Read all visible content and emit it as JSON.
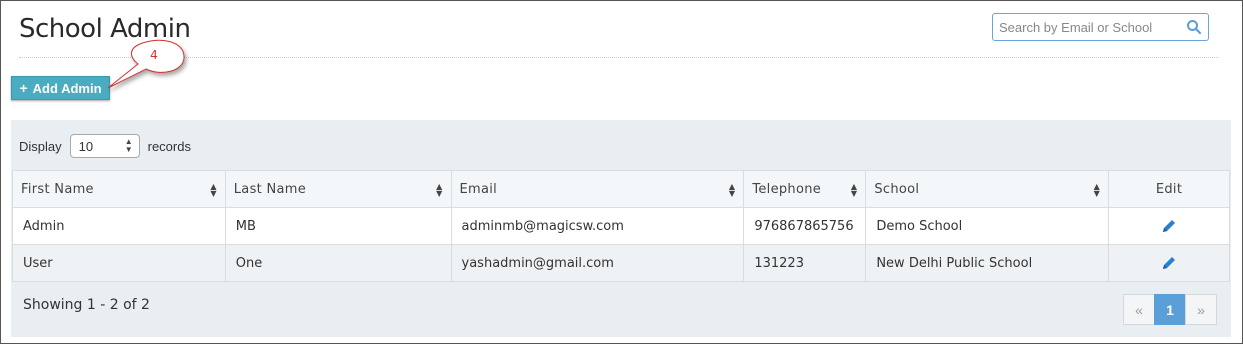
{
  "page": {
    "title": "School Admin"
  },
  "search": {
    "placeholder": "Search by Email or School"
  },
  "toolbar": {
    "add_admin_label": "Add Admin"
  },
  "callout": {
    "number": "4"
  },
  "display": {
    "prefix": "Display",
    "value": "10",
    "suffix": "records"
  },
  "table": {
    "headers": [
      "First Name",
      "Last Name",
      "Email",
      "Telephone",
      "School",
      "Edit"
    ],
    "rows": [
      [
        "Admin",
        "MB",
        "adminmb@magicsw.com",
        "976867865756",
        "Demo School"
      ],
      [
        "User",
        "One",
        "yashadmin@gmail.com",
        "131223",
        "New Delhi Public School"
      ]
    ]
  },
  "footer": {
    "showing": "Showing 1 - 2 of 2"
  },
  "pagination": {
    "prev": "«",
    "current": "1",
    "next": "»"
  },
  "colors": {
    "accent": "#4aacc0",
    "link": "#2a7fd0",
    "active_page": "#5a9fd8"
  }
}
